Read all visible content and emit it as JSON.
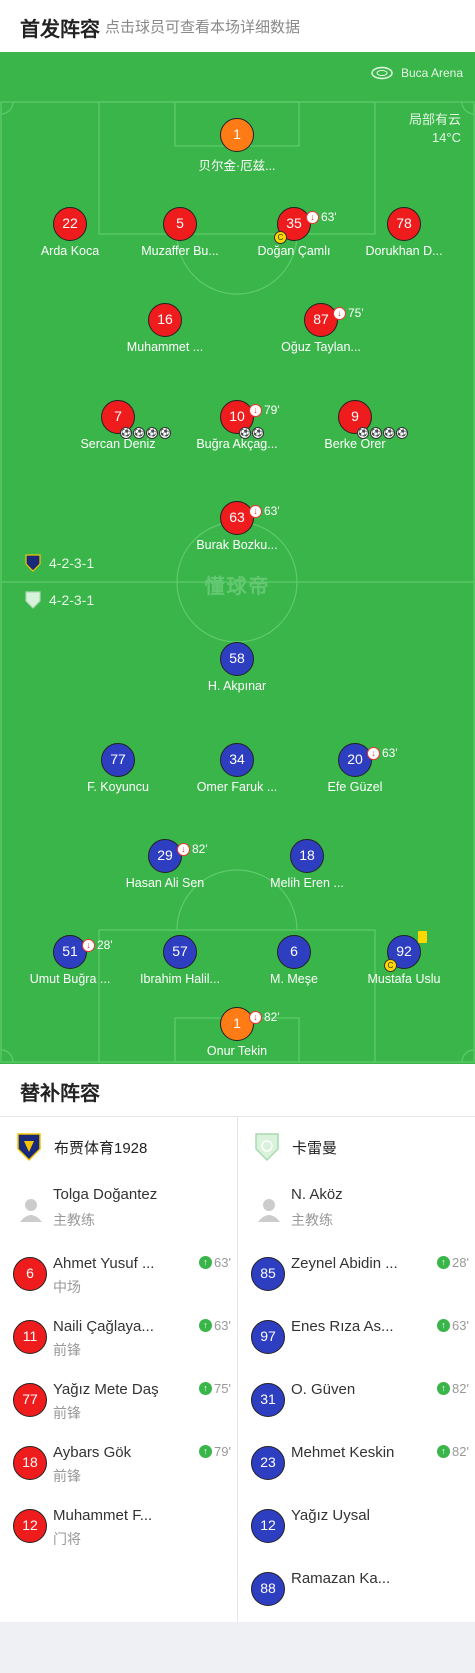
{
  "header": {
    "title": "首发阵容",
    "subtitle": "点击球员可查看本场详细数据"
  },
  "match": {
    "venue": "Buca Arena",
    "weather": "局部有云",
    "temperature": "14°C",
    "brand": "懂球帝"
  },
  "home": {
    "formation": "4-2-3-1",
    "name": "布贾体育1928",
    "color": "#ee1c1c",
    "lineup": [
      {
        "number": "1",
        "name": "贝尔金·厄兹...",
        "kit": "orange"
      },
      {
        "number": "22",
        "name": "Arda Koca",
        "kit": "red"
      },
      {
        "number": "5",
        "name": "Muzaffer Bu...",
        "kit": "red"
      },
      {
        "number": "35",
        "name": "Doğan Çamlı",
        "kit": "red",
        "sub": "63'",
        "captain": "C"
      },
      {
        "number": "78",
        "name": "Dorukhan D...",
        "kit": "red"
      },
      {
        "number": "16",
        "name": "Muhammet ...",
        "kit": "red"
      },
      {
        "number": "87",
        "name": "Oğuz Taylan...",
        "kit": "red",
        "sub": "75'"
      },
      {
        "number": "7",
        "name": "Sercan Deniz",
        "kit": "red",
        "goals": 4
      },
      {
        "number": "10",
        "name": "Buğra Akçag...",
        "kit": "red",
        "sub": "79'",
        "goals": 2
      },
      {
        "number": "9",
        "name": "Berke Örer",
        "kit": "red",
        "goals": 4
      },
      {
        "number": "63",
        "name": "Burak Bozku...",
        "kit": "red",
        "sub": "63'"
      }
    ]
  },
  "away": {
    "formation": "4-2-3-1",
    "name": "卡雷曼",
    "color": "#2e3ec1",
    "lineup": [
      {
        "number": "58",
        "name": "H. Akpınar",
        "kit": "blue"
      },
      {
        "number": "77",
        "name": "F. Koyuncu",
        "kit": "blue"
      },
      {
        "number": "34",
        "name": "Omer Faruk ...",
        "kit": "blue"
      },
      {
        "number": "20",
        "name": "Efe Güzel",
        "kit": "blue",
        "sub": "63'"
      },
      {
        "number": "29",
        "name": "Hasan Ali Sen",
        "kit": "blue",
        "sub": "82'"
      },
      {
        "number": "18",
        "name": "Melih Eren ...",
        "kit": "blue"
      },
      {
        "number": "51",
        "name": "Umut Buğra ...",
        "kit": "blue",
        "sub": "28'"
      },
      {
        "number": "57",
        "name": "Ibrahim Halil...",
        "kit": "blue"
      },
      {
        "number": "6",
        "name": "M. Meşe",
        "kit": "blue"
      },
      {
        "number": "92",
        "name": "Mustafa Uslu",
        "kit": "blue",
        "captain": "C",
        "yellow": true
      },
      {
        "number": "1",
        "name": "Onur Tekin",
        "kit": "orange",
        "sub": "82'"
      }
    ]
  },
  "subs": {
    "title": "替补阵容",
    "home": {
      "coach": {
        "name": "Tolga Doğantez",
        "role": "主教练"
      },
      "players": [
        {
          "number": "6",
          "name": "Ahmet Yusuf ...",
          "pos": "中场",
          "min": "63'"
        },
        {
          "number": "11",
          "name": "Naili Çağlaya...",
          "pos": "前锋",
          "min": "63'"
        },
        {
          "number": "77",
          "name": "Yağız Mete Daş",
          "pos": "前锋",
          "min": "75'"
        },
        {
          "number": "18",
          "name": "Aybars Gök",
          "pos": "前锋",
          "min": "79'"
        },
        {
          "number": "12",
          "name": "Muhammet F...",
          "pos": "门将",
          "min": ""
        }
      ]
    },
    "away": {
      "coach": {
        "name": "N. Aköz",
        "role": "主教练"
      },
      "players": [
        {
          "number": "85",
          "name": "Zeynel Abidin ...",
          "pos": "",
          "min": "28'"
        },
        {
          "number": "97",
          "name": "Enes Rıza As...",
          "pos": "",
          "min": "63'"
        },
        {
          "number": "31",
          "name": "O. Güven",
          "pos": "",
          "min": "82'"
        },
        {
          "number": "23",
          "name": "Mehmet Keskin",
          "pos": "",
          "min": "82'"
        },
        {
          "number": "12",
          "name": "Yağız Uysal",
          "pos": "",
          "min": ""
        },
        {
          "number": "88",
          "name": "Ramazan Ka...",
          "pos": "",
          "min": ""
        }
      ]
    }
  }
}
